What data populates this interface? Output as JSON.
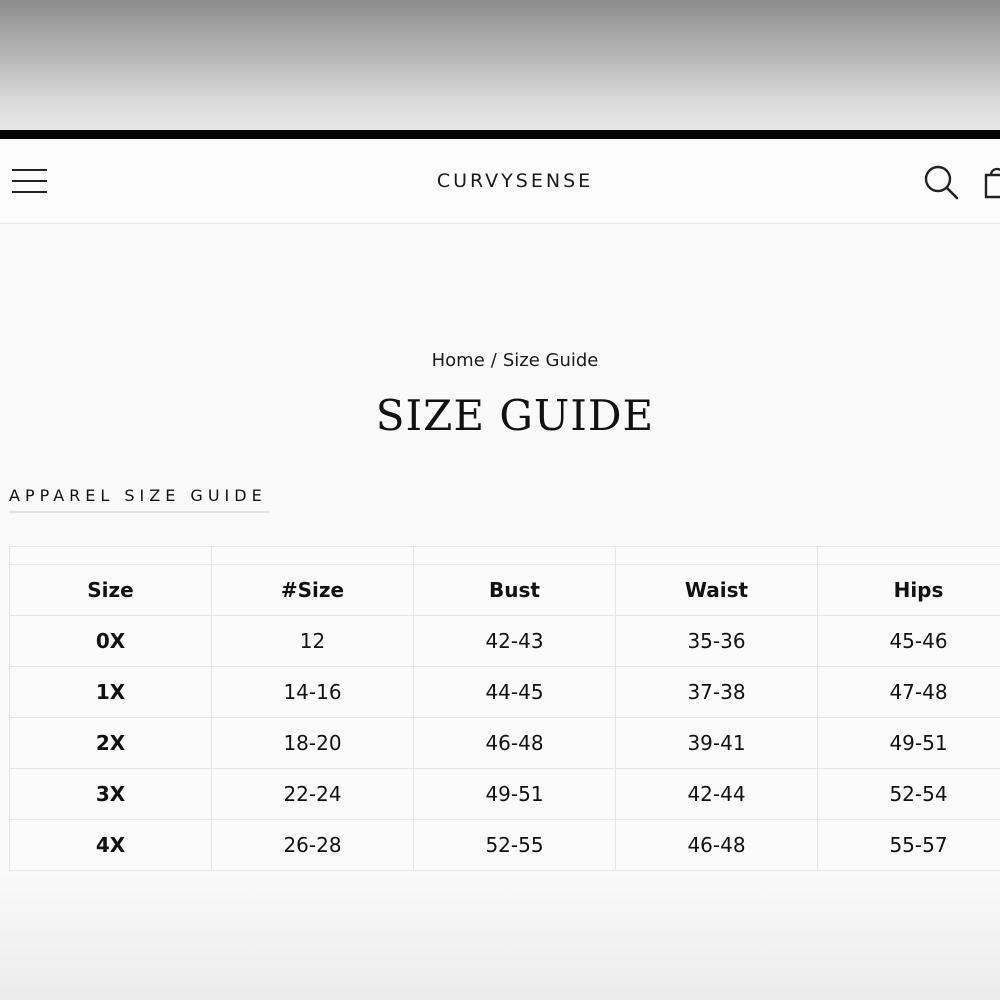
{
  "header": {
    "logo_light": "CURVY",
    "logo_bold": "SENSE",
    "menu_icon": "hamburger-menu-icon",
    "search_icon": "search-icon",
    "cart_icon": "cart-icon"
  },
  "breadcrumb": {
    "home": "Home",
    "separator": "/",
    "current": "Size Guide"
  },
  "page": {
    "title": "SIZE GUIDE",
    "section_label": "APPAREL SIZE GUIDE"
  },
  "table": {
    "headers": [
      "Size",
      "#Size",
      "Bust",
      "Waist",
      "Hips"
    ],
    "rows": [
      [
        "0X",
        "12",
        "42-43",
        "35-36",
        "45-46"
      ],
      [
        "1X",
        "14-16",
        "44-45",
        "37-38",
        "47-48"
      ],
      [
        "2X",
        "18-20",
        "46-48",
        "39-41",
        "49-51"
      ],
      [
        "3X",
        "22-24",
        "49-51",
        "42-44",
        "52-54"
      ],
      [
        "4X",
        "26-28",
        "52-55",
        "46-48",
        "55-57"
      ]
    ]
  },
  "colors": {
    "text": "#111111",
    "border": "#e6e6e6",
    "background": "#fafafa",
    "top_bar": "#050505"
  }
}
